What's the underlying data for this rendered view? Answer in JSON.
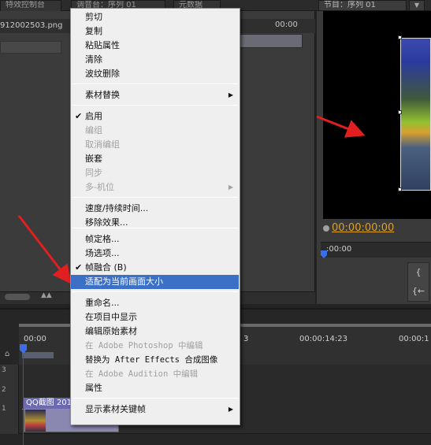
{
  "tabs": {
    "effects": "特效控制台",
    "mixer": "调音台：序列 01",
    "metadata": "元数据",
    "program": "节目：序列 01"
  },
  "source": {
    "clip_name": "912002503.png",
    "timecode_right": "00:00"
  },
  "program": {
    "timecode": "00:00:00:00",
    "mini_ruler_tc": ":00:00",
    "button_1": "{",
    "button_2": "{←"
  },
  "timeline": {
    "tc_0": "00:00",
    "tc_mid": "3",
    "tc_1": "00:00:14:23",
    "tc_2": "00:00:1",
    "tracks": [
      "3",
      "2",
      "1"
    ],
    "clip_title": "QQ截图 201"
  },
  "menu": {
    "items": [
      {
        "label": "剪切",
        "state": "enabled"
      },
      {
        "label": "复制",
        "state": "enabled"
      },
      {
        "label": "粘贴属性",
        "state": "enabled"
      },
      {
        "label": "清除",
        "state": "enabled"
      },
      {
        "label": "波纹删除",
        "state": "enabled"
      },
      {
        "label": "素材替换",
        "state": "enabled",
        "submenu": true
      },
      {
        "label": "启用",
        "state": "enabled",
        "checked": true
      },
      {
        "label": "编组",
        "state": "disabled"
      },
      {
        "label": "取消编组",
        "state": "disabled"
      },
      {
        "label": "嵌套",
        "state": "enabled"
      },
      {
        "label": "同步",
        "state": "disabled"
      },
      {
        "label": "多-机位",
        "state": "disabled",
        "submenu": true
      },
      {
        "label": "速度/持续时间...",
        "state": "enabled"
      },
      {
        "label": "移除效果...",
        "state": "enabled"
      },
      {
        "label": "帧定格...",
        "state": "enabled"
      },
      {
        "label": "场选项...",
        "state": "enabled"
      },
      {
        "label": "帧融合 (B)",
        "state": "enabled",
        "checked": true
      },
      {
        "label": "适配为当前画面大小",
        "state": "highlighted"
      },
      {
        "label": "重命名...",
        "state": "enabled"
      },
      {
        "label": "在项目中显示",
        "state": "enabled"
      },
      {
        "label": "编辑原始素材",
        "state": "enabled"
      },
      {
        "label": "在 Adobe Photoshop 中编辑",
        "state": "disabled"
      },
      {
        "label": "替换为 After Effects 合成图像",
        "state": "enabled"
      },
      {
        "label": "在 Adobe Audition 中编辑",
        "state": "disabled"
      },
      {
        "label": "属性",
        "state": "enabled"
      },
      {
        "label": "显示素材关键帧",
        "state": "enabled",
        "submenu": true
      }
    ],
    "check_glyph": "✔",
    "submenu_glyph": "▶",
    "highlight_color": "#3c6fc6"
  },
  "icons": {
    "home": "⌂",
    "mountain": "▲▲",
    "arrow": "◀"
  },
  "colors": {
    "timecode": "#e0a020",
    "playhead": "#3a6ee8",
    "annotation_arrow": "#e02020"
  }
}
